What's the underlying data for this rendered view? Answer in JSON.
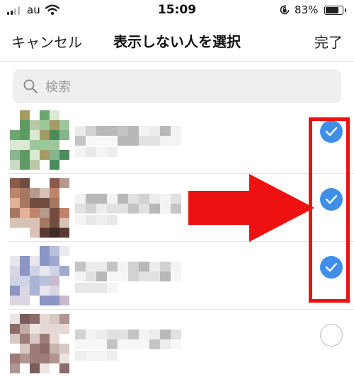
{
  "status_bar": {
    "carrier": "au",
    "time": "15:09",
    "battery_percent": "83%",
    "battery_level": 0.83
  },
  "nav": {
    "cancel_label": "キャンセル",
    "title": "表示しない人を選択",
    "done_label": "完了"
  },
  "search": {
    "placeholder": "検索",
    "value": ""
  },
  "list": {
    "rows": [
      {
        "selected": true
      },
      {
        "selected": true
      },
      {
        "selected": true
      },
      {
        "selected": false
      }
    ]
  },
  "colors": {
    "accent_check": "#3f8fe8",
    "annotation_red": "#ee1111"
  },
  "icons": {
    "signal": "cellular-signal-icon",
    "wifi": "wifi-icon",
    "orientation_lock": "orientation-lock-icon",
    "battery": "battery-icon",
    "search": "magnifier-icon",
    "check": "checkmark-icon"
  }
}
